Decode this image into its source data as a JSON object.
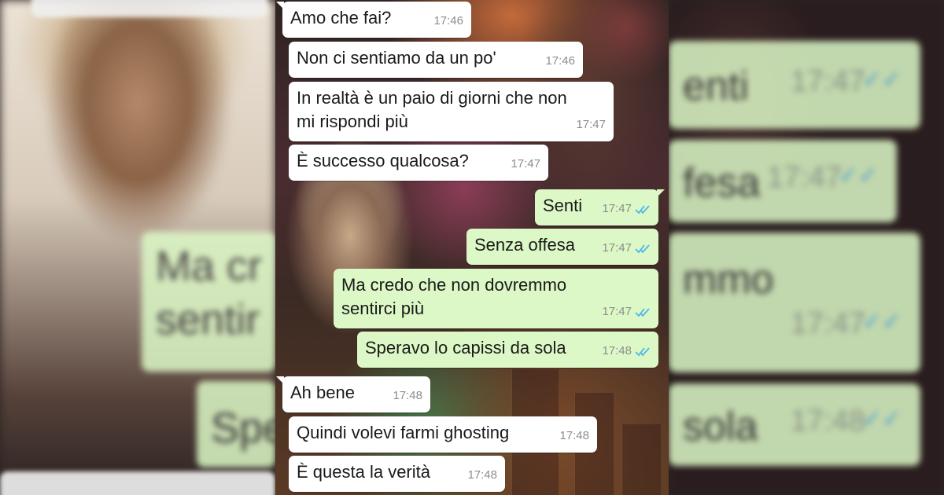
{
  "colors": {
    "incoming_bubble": "#ffffff",
    "outgoing_bubble": "#dcf8c6",
    "read_ticks": "#4fb6ec",
    "timestamp": "#8d8d8d"
  },
  "chat": {
    "messages": [
      {
        "direction": "incoming",
        "text": "Amo che fai?",
        "time": "17:46"
      },
      {
        "direction": "incoming",
        "text": "Non ci sentiamo da un po'",
        "time": "17:46"
      },
      {
        "direction": "incoming",
        "text": "In realtà è un paio di giorni che non\nmi rispondi più",
        "time": "17:47"
      },
      {
        "direction": "incoming",
        "text": "È successo qualcosa?",
        "time": "17:47"
      },
      {
        "direction": "outgoing",
        "text": "Senti",
        "time": "17:47",
        "status": "read"
      },
      {
        "direction": "outgoing",
        "text": "Senza offesa",
        "time": "17:47",
        "status": "read"
      },
      {
        "direction": "outgoing",
        "text": "Ma credo che non dovremmo\nsentirci più",
        "time": "17:47",
        "status": "read"
      },
      {
        "direction": "outgoing",
        "text": "Speravo lo capissi da sola",
        "time": "17:48",
        "status": "read"
      },
      {
        "direction": "incoming",
        "text": "Ah bene",
        "time": "17:48"
      },
      {
        "direction": "incoming",
        "text": "Quindi volevi farmi ghosting",
        "time": "17:48"
      },
      {
        "direction": "incoming",
        "text": "È questa la verità",
        "time": "17:48"
      }
    ]
  },
  "blurred_left": {
    "lines": [
      "Ma cr",
      "sentir",
      "Spe"
    ]
  },
  "blurred_right": {
    "bubbles": [
      {
        "text": "enti",
        "time": "17:47"
      },
      {
        "text": "fesa",
        "time": "17:47"
      },
      {
        "text": "mmo",
        "time": "17:47"
      },
      {
        "text": "sola",
        "time": "17:48"
      }
    ]
  },
  "icons": {
    "read_ticks": "double-check-icon"
  }
}
